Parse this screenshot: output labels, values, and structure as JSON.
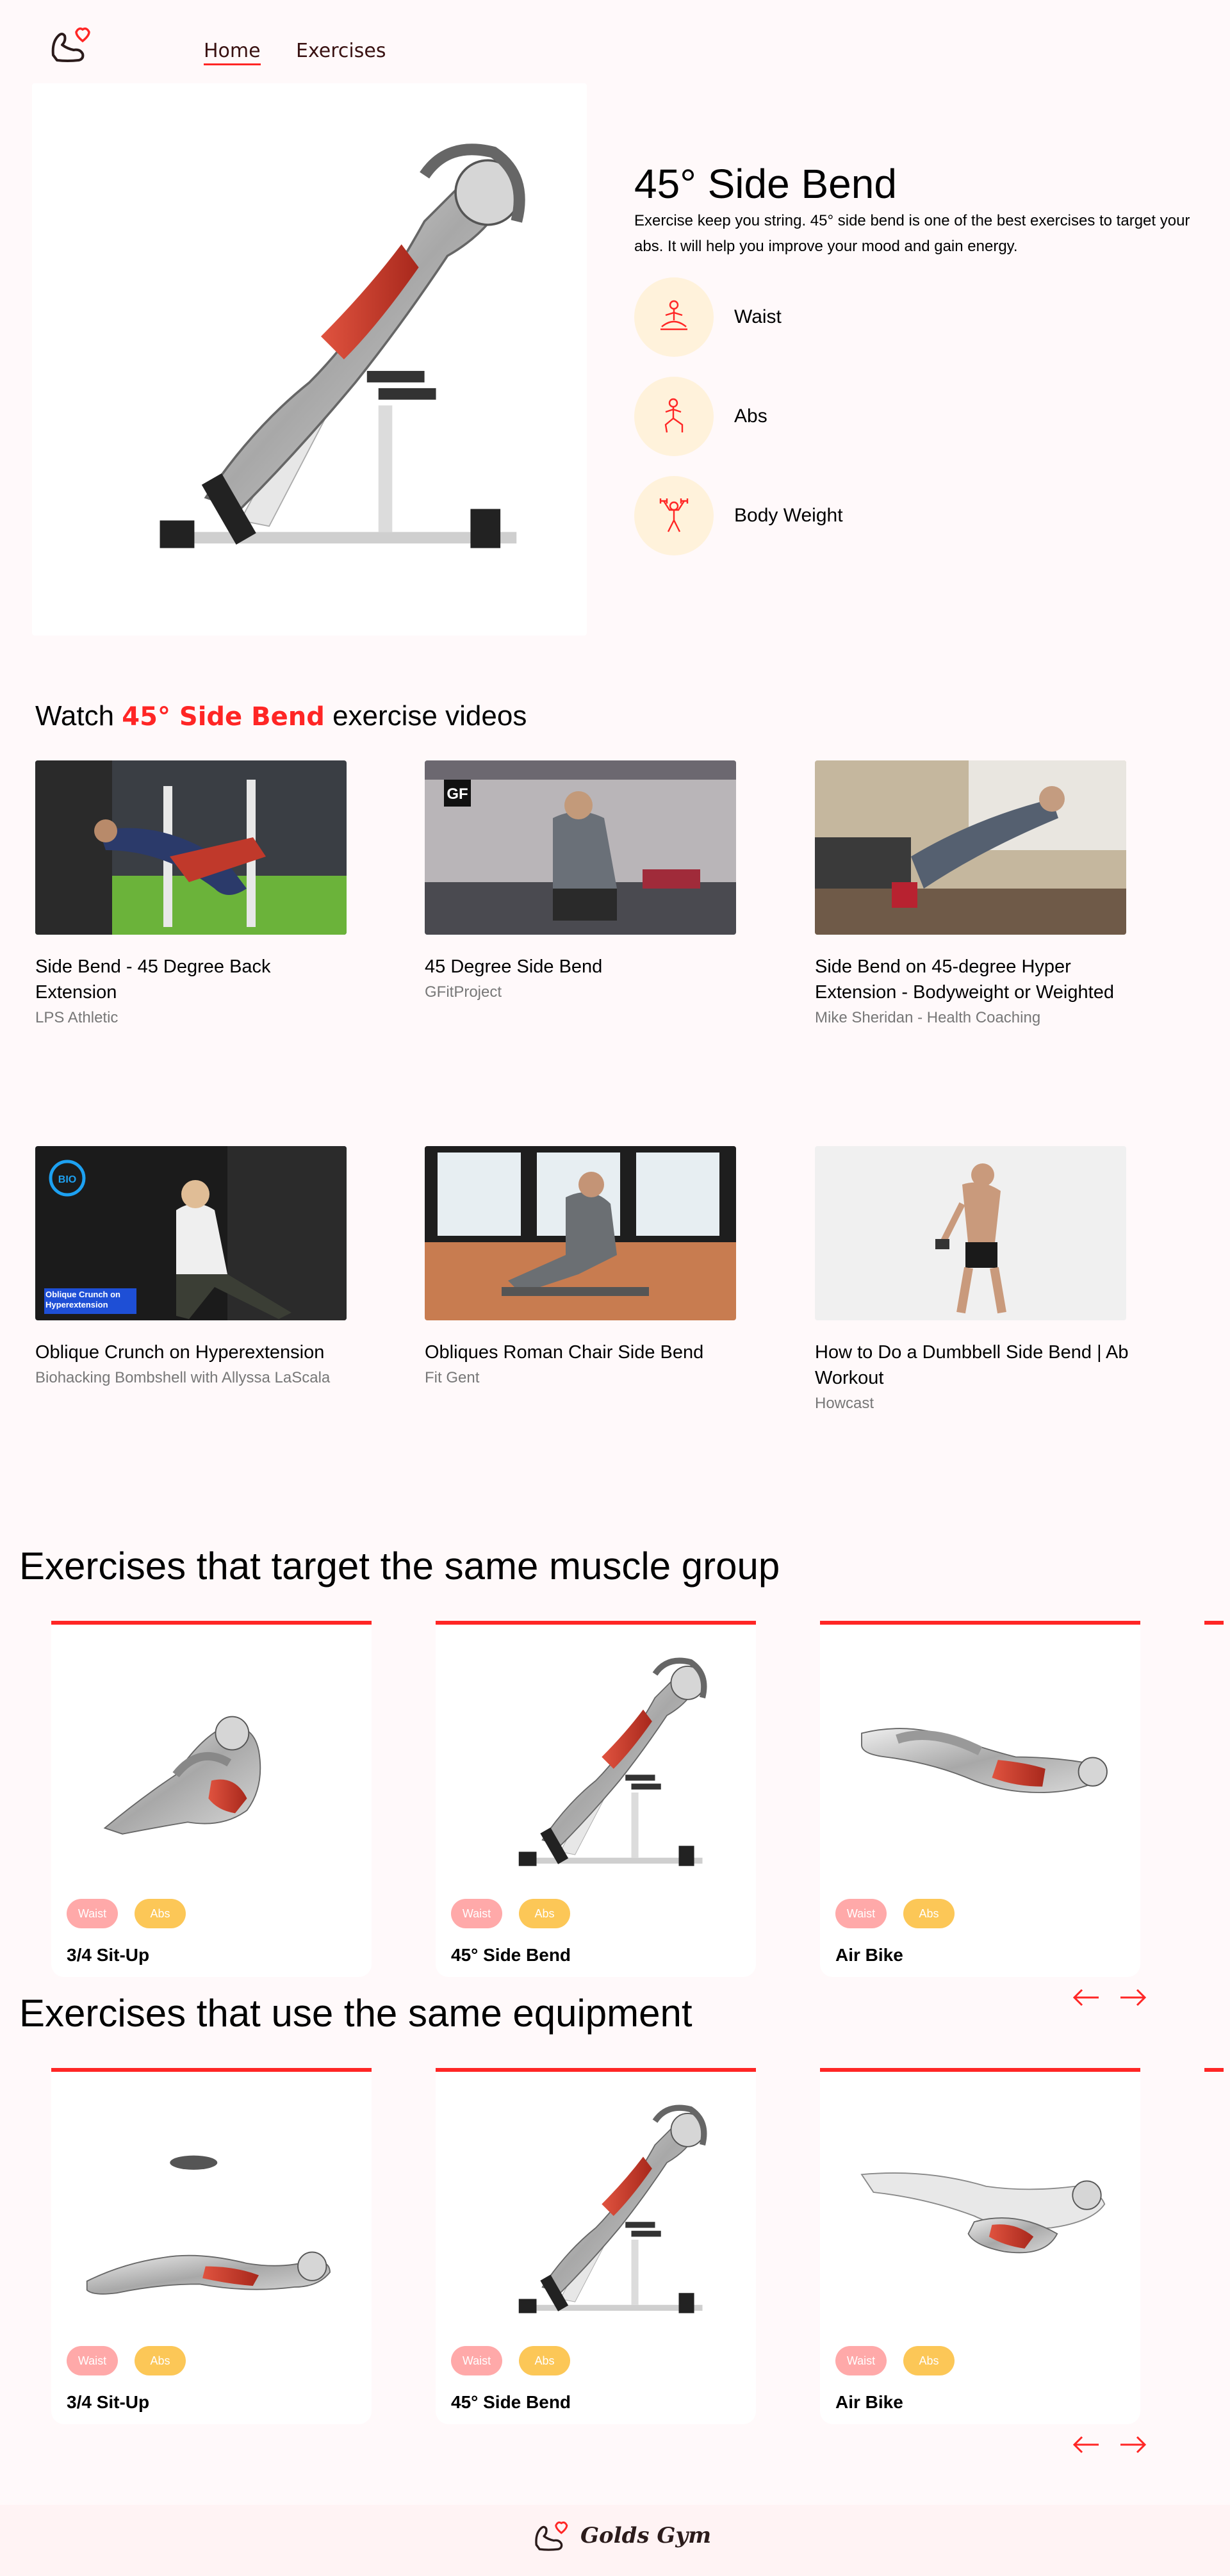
{
  "nav": {
    "logo_icon": "flexed-bicep-heart-logo",
    "home": "Home",
    "exercises": "Exercises"
  },
  "detail": {
    "name": "45° Side Bend",
    "description": "Exercise keep you string. 45° side bend is one of the best exercises to target your abs. It will help you improve your mood and gain energy.",
    "tags": [
      {
        "label": "Waist",
        "icon": "meditating-person-icon"
      },
      {
        "label": "Abs",
        "icon": "lunge-person-icon"
      },
      {
        "label": "Body Weight",
        "icon": "dumbbell-person-icon"
      }
    ]
  },
  "videos": {
    "title_prefix": "Watch",
    "title_highlight": "45° Side Bend",
    "title_suffix": "exercise videos",
    "items": [
      {
        "title": "Side Bend - 45 Degree Back Extension",
        "channel": "LPS Athletic"
      },
      {
        "title": "45 Degree Side Bend",
        "channel": "GFitProject",
        "badge": "GF"
      },
      {
        "title": "Side Bend on 45-degree Hyper Extension - Bodyweight or Weighted",
        "channel": "Mike Sheridan - Health Coaching"
      },
      {
        "title": "Oblique Crunch on Hyperextension",
        "channel": "Biohacking Bombshell with Allyssa LaScala",
        "caption": "Oblique Crunch on Hyperextension",
        "badge": "BIO"
      },
      {
        "title": "Obliques Roman Chair Side Bend",
        "channel": "Fit Gent"
      },
      {
        "title": "How to Do a Dumbbell Side Bend | Ab Workout",
        "channel": "Howcast"
      }
    ]
  },
  "target": {
    "title": "Exercises that target the same muscle group",
    "cards": [
      {
        "name": "3/4 Sit-Up",
        "tag1": "Waist",
        "tag2": "Abs"
      },
      {
        "name": "45° Side Bend",
        "tag1": "Waist",
        "tag2": "Abs"
      },
      {
        "name": "Air Bike",
        "tag1": "Waist",
        "tag2": "Abs"
      }
    ]
  },
  "equipment": {
    "title": "Exercises that use the same equipment",
    "cards": [
      {
        "name": "3/4 Sit-Up",
        "tag1": "Waist",
        "tag2": "Abs"
      },
      {
        "name": "45° Side Bend",
        "tag1": "Waist",
        "tag2": "Abs"
      },
      {
        "name": "Air Bike",
        "tag1": "Waist",
        "tag2": "Abs"
      }
    ]
  },
  "footer": {
    "brand": "Golds Gym"
  },
  "colors": {
    "accent": "#ff2625",
    "background": "#fff9fa",
    "tag_circle": "#fff2db",
    "pill_pink": "#ffa9a9",
    "pill_yellow": "#fcc757"
  }
}
